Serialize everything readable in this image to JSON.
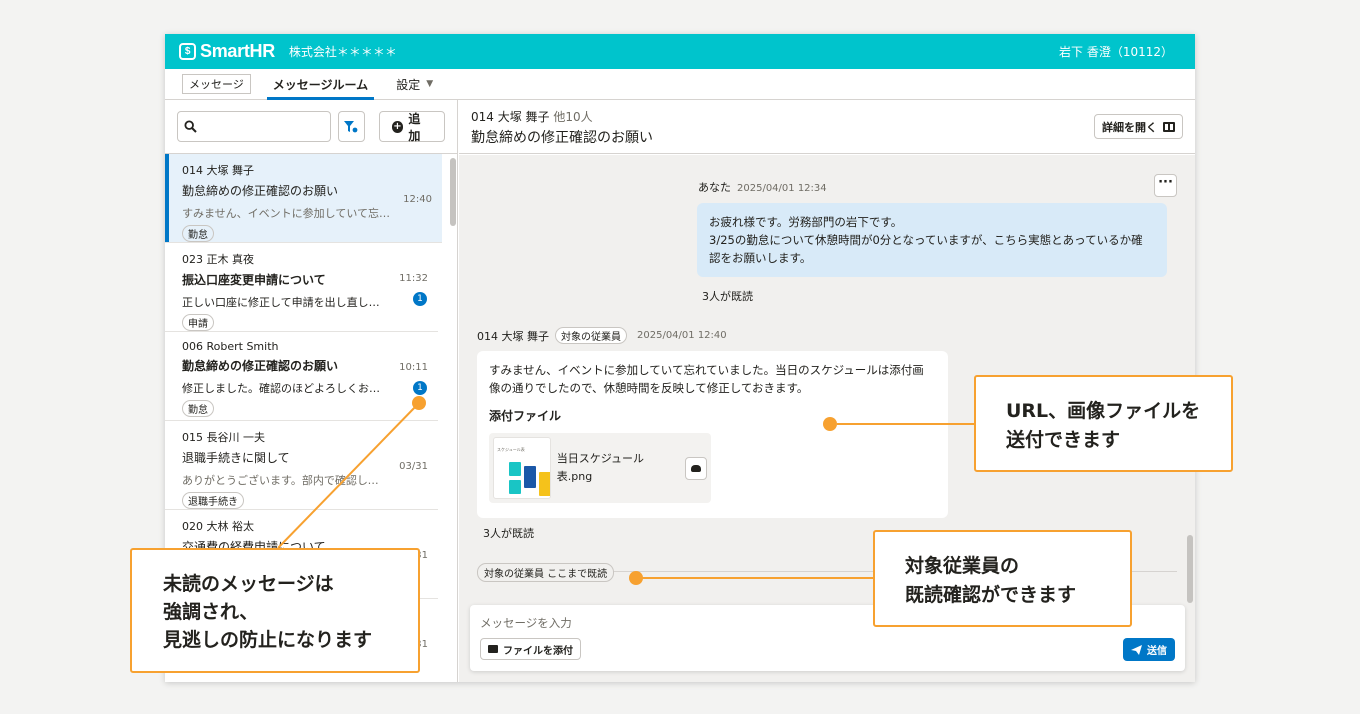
{
  "header": {
    "brand": "SmartHR",
    "company": "株式会社＊＊＊＊＊",
    "user": "岩下 香澄（10112）"
  },
  "tabs": {
    "chip": "メッセージ",
    "room": "メッセージルーム",
    "settings": "設定"
  },
  "sidebar": {
    "add_label": "追加",
    "items": [
      {
        "name": "014 大塚 舞子",
        "subject": "勤怠締めの修正確認のお願い",
        "preview": "すみません、イベントに参加していて忘れて…",
        "tag": "勤怠",
        "time": "12:40"
      },
      {
        "name": "023 正木 真夜",
        "subject": "振込口座変更申請について",
        "preview": "正しい口座に修正して申請を出し直しました…",
        "tag": "申請",
        "time": "11:32",
        "badge": "1"
      },
      {
        "name": "006 Robert Smith",
        "subject": "勤怠締めの修正確認のお願い",
        "preview": "修正しました。確認のほどよろしくお願いし…",
        "tag": "勤怠",
        "time": "10:11",
        "badge": "1"
      },
      {
        "name": "015 長谷川 一夫",
        "subject": "退職手続きに関して",
        "preview": "ありがとうございます。部内で確認して返信…",
        "tag": "退職手続き",
        "time": "03/31"
      },
      {
        "name": "020 大林 裕太",
        "subject": "交通費の経費申請について",
        "preview": "",
        "tag": "",
        "time": "03/31"
      },
      {
        "name": "",
        "subject": "",
        "preview": "",
        "tag": "",
        "time": "03/31"
      }
    ]
  },
  "room": {
    "members": "014 大塚 舞子",
    "others": "他10人",
    "title": "勤怠締めの修正確認のお願い",
    "detail_label": "詳細を開く"
  },
  "messages": {
    "mine": {
      "author": "あなた",
      "date": "2025/04/01 12:34",
      "lines": [
        "お疲れ様です。労務部門の岩下です。",
        "3/25の勤怠について休憩時間が0分となっていますが、こちら実態とあっているか確",
        "認をお願いします。"
      ],
      "read": "3人が既読"
    },
    "theirs": {
      "author": "014 大塚 舞子",
      "role": "対象の従業員",
      "date": "2025/04/01 12:40",
      "lines": [
        "すみません、イベントに参加していて忘れていました。当日のスケジュールは添付画",
        "像の通りでしたので、休憩時間を反映して修正しておきます。"
      ],
      "attach_title": "添付ファイル",
      "file_name": "当日スケジュール表.png",
      "thumb_title": "スケジュール表",
      "read": "3人が既読"
    },
    "read_marker": "対象の従業員 ここまで既読"
  },
  "composer": {
    "placeholder": "メッセージを入力",
    "attach_label": "ファイルを添付",
    "send_label": "送信"
  },
  "callouts": {
    "upload": [
      "URL、画像ファイルを",
      "送付できます"
    ],
    "read_check": [
      "対象従業員の",
      "既読確認ができます"
    ],
    "unread": [
      "未読のメッセージは",
      "強調され、",
      "見逃しの防止になります"
    ]
  },
  "colors": {
    "brand": "#00c4cc",
    "accent": "#0077c7",
    "callout": "#f7a130"
  }
}
